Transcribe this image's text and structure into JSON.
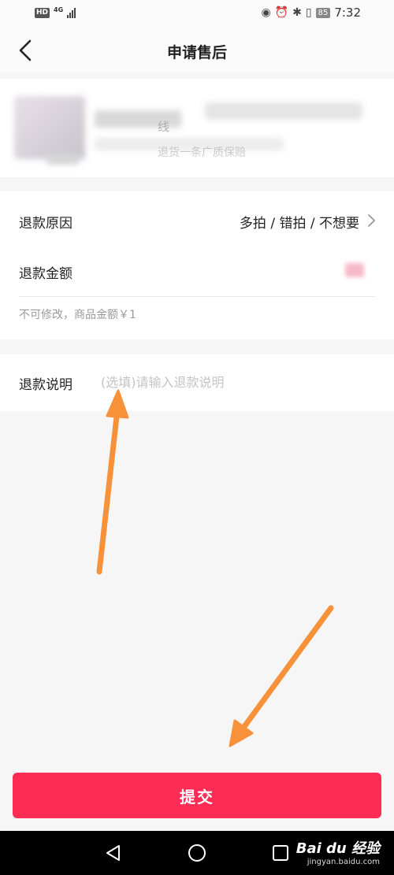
{
  "status_bar": {
    "hd": "HD",
    "network": "4G",
    "battery": "85",
    "time": "7:32"
  },
  "header": {
    "title": "申请售后",
    "back_icon": "chevron-left-icon"
  },
  "product": {
    "name": "线",
    "tag": "退货一条广质保赔"
  },
  "refund": {
    "reason_label": "退款原因",
    "reason_value": "多拍 / 错拍 / 不想要",
    "amount_label": "退款金额",
    "amount_note": "不可修改，商品金额￥1"
  },
  "description": {
    "label": "退款说明",
    "placeholder": "(选填)请输入退款说明",
    "value": ""
  },
  "submit_label": "提交",
  "watermark": {
    "logo": "Bai du 经验",
    "url": "jingyan.baidu.com"
  },
  "colors": {
    "accent": "#fc2c55",
    "annotation": "#f7923a"
  }
}
